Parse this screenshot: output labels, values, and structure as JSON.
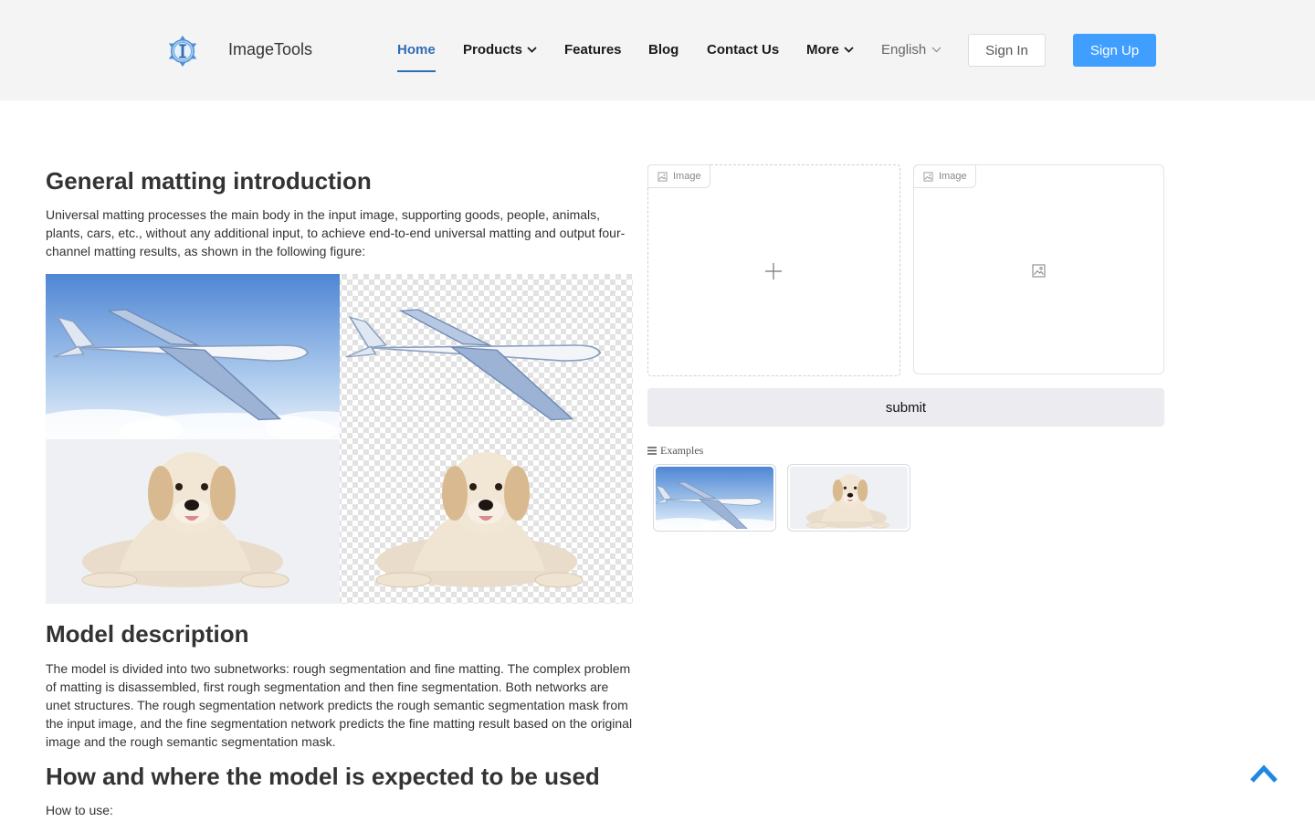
{
  "header": {
    "brand": "ImageTools",
    "nav": [
      {
        "label": "Home",
        "active": true,
        "dropdown": false
      },
      {
        "label": "Products",
        "active": false,
        "dropdown": true
      },
      {
        "label": "Features",
        "active": false,
        "dropdown": false
      },
      {
        "label": "Blog",
        "active": false,
        "dropdown": false
      },
      {
        "label": "Contact Us",
        "active": false,
        "dropdown": false
      },
      {
        "label": "More",
        "active": false,
        "dropdown": true
      }
    ],
    "language": "English",
    "sign_in": "Sign In",
    "sign_up": "Sign Up"
  },
  "article": {
    "intro_title": "General matting introduction",
    "intro_text": "Universal matting processes the main body in the input image, supporting goods, people, animals, plants, cars, etc., without any additional input, to achieve end-to-end universal matting and output four-channel matting results, as shown in the following figure:",
    "model_title": "Model description",
    "model_text": "The model is divided into two subnetworks: rough segmentation and fine matting. The complex problem of matting is disassembled, first rough segmentation and then fine segmentation. Both networks are unet structures. The rough segmentation network predicts the rough semantic segmentation mask from the input image, and the fine segmentation network predicts the fine matting result based on the original image and the rough semantic segmentation mask.",
    "usage_title": "How and where the model is expected to be used",
    "usage_text": "How to use:"
  },
  "panel": {
    "input_label": "Image",
    "output_label": "Image",
    "submit_label": "submit",
    "examples_label": "Examples"
  },
  "colors": {
    "accent": "#409eff",
    "nav_active": "#2f6eb5",
    "header_bg": "#f4f4f5"
  }
}
